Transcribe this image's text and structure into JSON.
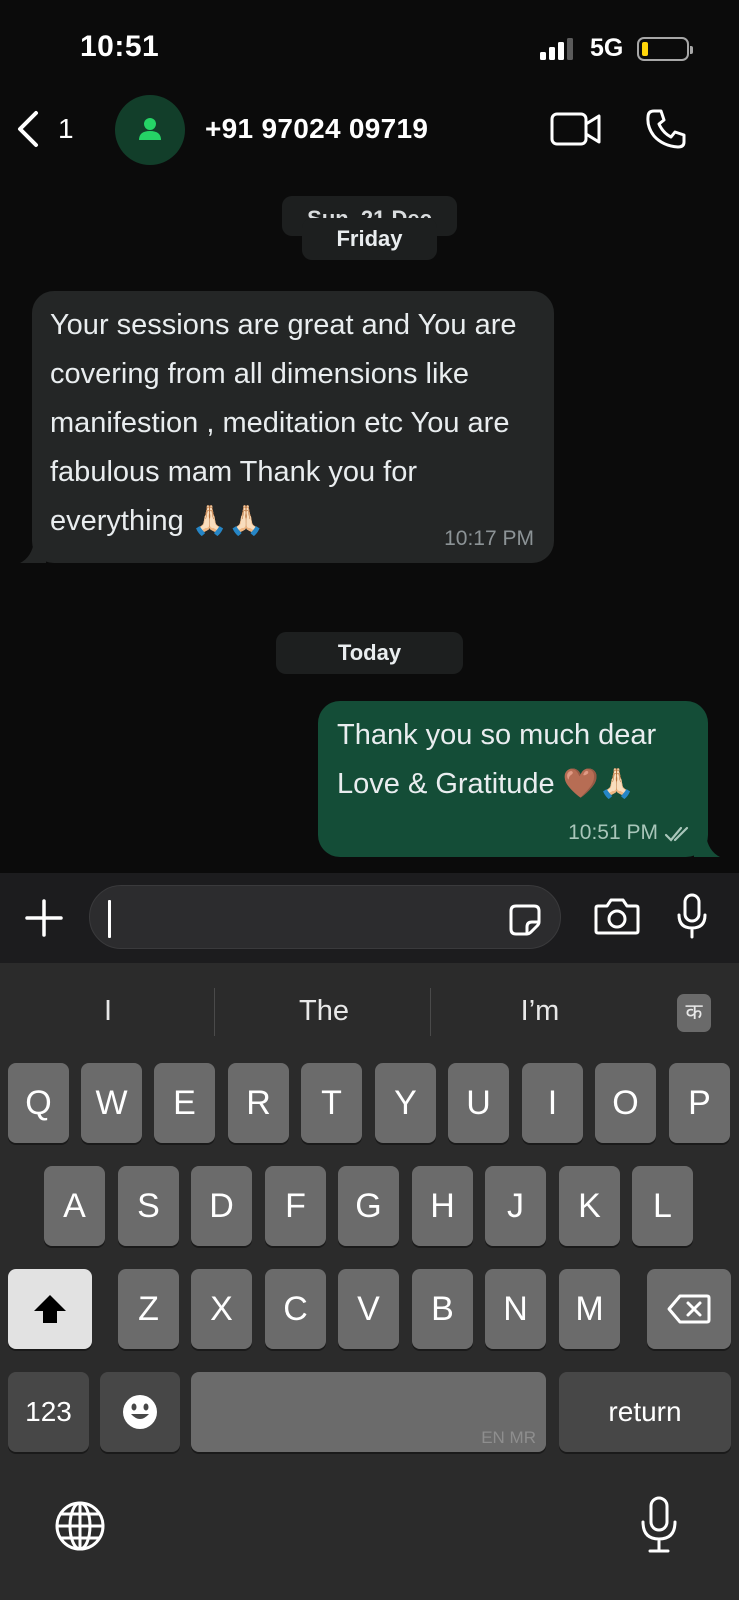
{
  "status_bar": {
    "time": "10:51",
    "network": "5G",
    "battery_level": 0.15,
    "battery_color": "#ffd60a"
  },
  "header": {
    "back_count": "1",
    "contact_name": "+91 97024 09719",
    "icons": [
      "chevron-left-icon",
      "person-icon",
      "video-call-icon",
      "phone-icon"
    ]
  },
  "chat": {
    "date_chips": {
      "behind": "Sun, 21 Dec",
      "friday": "Friday",
      "today": "Today"
    },
    "messages": [
      {
        "direction": "incoming",
        "text": "Your sessions are great and You are covering from all dimensions like manifestion , meditation etc You are fabulous mam Thank you for everything 🙏🏻🙏🏻",
        "time": "10:17 PM"
      },
      {
        "direction": "outgoing",
        "text": "Thank you so much dear Love & Gratitude 🤎🙏🏻",
        "time": "10:51 PM",
        "status": "read"
      }
    ],
    "colors": {
      "incoming_bubble": "#242626",
      "outgoing_bubble": "#144d37"
    }
  },
  "input": {
    "value": "",
    "icons": [
      "plus-icon",
      "sticker-icon",
      "camera-icon",
      "microphone-icon"
    ]
  },
  "keyboard": {
    "suggestions": [
      "I",
      "The",
      "I’m"
    ],
    "lang_badge": "क",
    "row1": [
      "Q",
      "W",
      "E",
      "R",
      "T",
      "Y",
      "U",
      "I",
      "O",
      "P"
    ],
    "row2": [
      "A",
      "S",
      "D",
      "F",
      "G",
      "H",
      "J",
      "K",
      "L"
    ],
    "row3": [
      "Z",
      "X",
      "C",
      "V",
      "B",
      "N",
      "M"
    ],
    "numbers_label": "123",
    "space_sublabel": "EN MR",
    "return_label": "return",
    "icons": [
      "shift-icon",
      "backspace-icon",
      "emoji-icon",
      "globe-icon",
      "dictation-mic-icon"
    ]
  }
}
